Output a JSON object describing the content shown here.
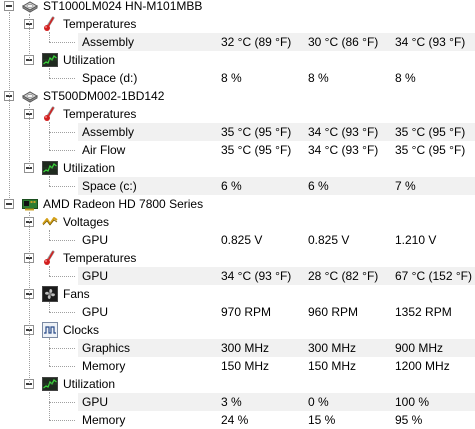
{
  "tree": {
    "nodes": [
      {
        "kind": "device",
        "icon": "hdd-icon",
        "label": "ST1000LM024 HN-M101MBB"
      },
      {
        "kind": "group",
        "icon": "thermometer-icon",
        "label": "Temperatures"
      },
      {
        "kind": "sensor",
        "label": "Assembly",
        "values": [
          "32 °C  (89 °F)",
          "30 °C  (86 °F)",
          "34 °C  (93 °F)"
        ]
      },
      {
        "kind": "group",
        "icon": "utilization-icon",
        "label": "Utilization"
      },
      {
        "kind": "sensor",
        "label": "Space (d:)",
        "values": [
          "8 %",
          "8 %",
          "8 %"
        ]
      },
      {
        "kind": "device",
        "icon": "hdd-icon",
        "label": "ST500DM002-1BD142"
      },
      {
        "kind": "group",
        "icon": "thermometer-icon",
        "label": "Temperatures"
      },
      {
        "kind": "sensor",
        "label": "Assembly",
        "values": [
          "35 °C  (95 °F)",
          "34 °C  (93 °F)",
          "35 °C  (95 °F)"
        ]
      },
      {
        "kind": "sensor",
        "label": "Air Flow",
        "values": [
          "35 °C  (95 °F)",
          "34 °C  (93 °F)",
          "35 °C  (95 °F)"
        ]
      },
      {
        "kind": "group",
        "icon": "utilization-icon",
        "label": "Utilization"
      },
      {
        "kind": "sensor",
        "label": "Space (c:)",
        "values": [
          "6 %",
          "6 %",
          "7 %"
        ]
      },
      {
        "kind": "device",
        "icon": "gpu-card-icon",
        "label": "AMD Radeon HD 7800 Series"
      },
      {
        "kind": "group",
        "icon": "voltage-icon",
        "label": "Voltages"
      },
      {
        "kind": "sensor",
        "label": "GPU",
        "values": [
          "0.825 V",
          "0.825 V",
          "1.210 V"
        ]
      },
      {
        "kind": "group",
        "icon": "thermometer-icon",
        "label": "Temperatures"
      },
      {
        "kind": "sensor",
        "label": "GPU",
        "values": [
          "34 °C  (93 °F)",
          "28 °C  (82 °F)",
          "67 °C  (152 °F)"
        ]
      },
      {
        "kind": "group",
        "icon": "fan-icon",
        "label": "Fans"
      },
      {
        "kind": "sensor",
        "label": "GPU",
        "values": [
          "970 RPM",
          "960 RPM",
          "1352 RPM"
        ]
      },
      {
        "kind": "group",
        "icon": "clock-icon",
        "label": "Clocks"
      },
      {
        "kind": "sensor",
        "label": "Graphics",
        "values": [
          "300 MHz",
          "300 MHz",
          "900 MHz"
        ]
      },
      {
        "kind": "sensor",
        "label": "Memory",
        "values": [
          "150 MHz",
          "150 MHz",
          "1200 MHz"
        ]
      },
      {
        "kind": "group",
        "icon": "utilization-icon",
        "label": "Utilization"
      },
      {
        "kind": "sensor",
        "label": "GPU",
        "values": [
          "3 %",
          "0 %",
          "100 %"
        ]
      },
      {
        "kind": "sensor",
        "label": "Memory",
        "values": [
          "24 %",
          "15 %",
          "95 %"
        ]
      }
    ]
  }
}
